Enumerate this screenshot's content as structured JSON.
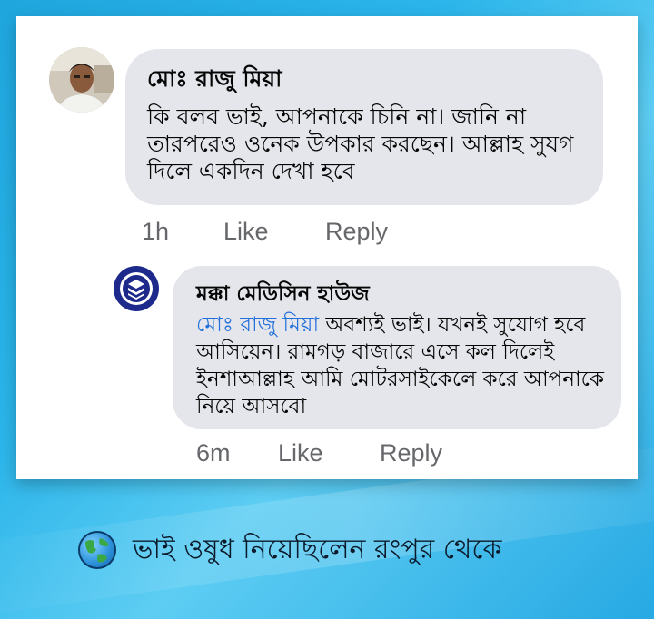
{
  "comment": {
    "author": "মোঃ রাজু মিয়া",
    "text": "কি বলব ভাই, আপনাকে চিনি না। জানি না তারপরেও ওনেক উপকার করছেন। আল্লাহ সুযগ দিলে একদিন দেখা হবে",
    "time": "1h",
    "like_label": "Like",
    "reply_label": "Reply"
  },
  "reply": {
    "author": "মক্কা মেডিসিন হাউজ",
    "mention": "মোঃ রাজু মিয়া",
    "text": " অবশ্যই ভাই। যখনই সুযোগ হবে আসিয়েন। রামগড় বাজারে এসে কল দিলেই ইনশাআল্লাহ আমি মোটরসাইকেলে করে আপনাকে নিয়ে আসবো",
    "time": "6m",
    "like_label": "Like",
    "reply_label": "Reply"
  },
  "caption": {
    "icon": "globe-icon",
    "text": "ভাই ওষুধ নিয়েছিলেন রংপুর থেকে"
  },
  "colors": {
    "bubble": "#e4e6eb",
    "mention": "#216fdb",
    "meta": "#65676b",
    "brand": "#1d2a8c"
  }
}
